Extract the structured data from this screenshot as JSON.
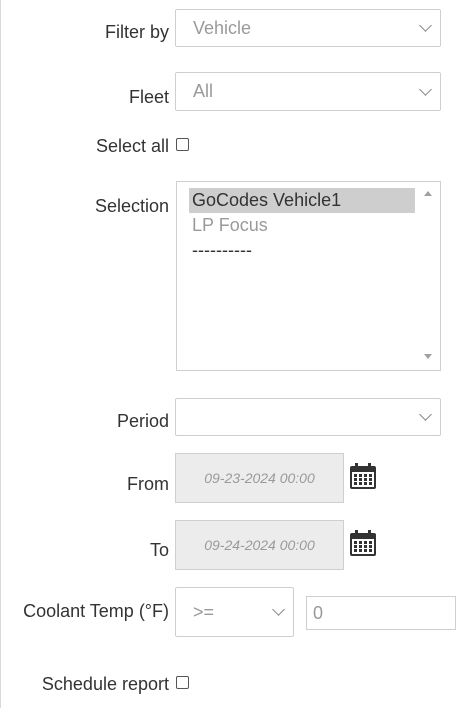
{
  "filter_by": {
    "label": "Filter by",
    "value": "Vehicle"
  },
  "fleet": {
    "label": "Fleet",
    "value": "All"
  },
  "select_all": {
    "label": "Select all"
  },
  "selection": {
    "label": "Selection",
    "items": [
      "GoCodes Vehicle1",
      "LP Focus",
      "----------"
    ]
  },
  "period": {
    "label": "Period",
    "value": ""
  },
  "from": {
    "label": "From",
    "value": "09-23-2024 00:00"
  },
  "to": {
    "label": "To",
    "value": "09-24-2024 00:00"
  },
  "coolant": {
    "label": "Coolant Temp (°F)",
    "operator": ">=",
    "value": "0"
  },
  "schedule": {
    "label": "Schedule report"
  },
  "icons": {
    "calendar": "calendar-icon",
    "chevron": "chevron-down-icon"
  }
}
